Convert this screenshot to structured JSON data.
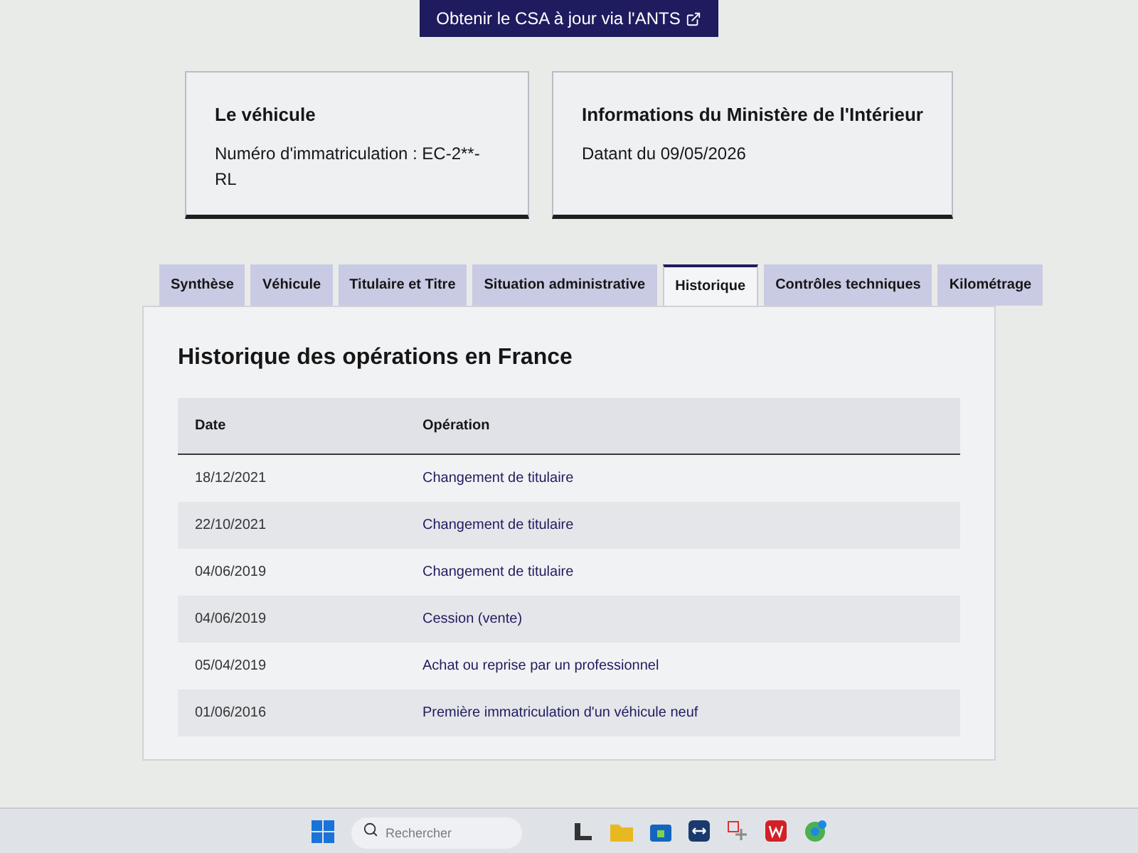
{
  "top_button": {
    "label": "Obtenir le CSA à jour via l'ANTS"
  },
  "cards": [
    {
      "title": "Le véhicule",
      "text": "Numéro d'immatriculation : EC-2**-RL"
    },
    {
      "title": "Informations du Ministère de l'Intérieur",
      "text": "Datant du 09/05/2026"
    }
  ],
  "tabs": [
    {
      "label": "Synthèse",
      "selected": false
    },
    {
      "label": "Véhicule",
      "selected": false
    },
    {
      "label": "Titulaire et Titre",
      "selected": false
    },
    {
      "label": "Situation administrative",
      "selected": false
    },
    {
      "label": "Historique",
      "selected": true
    },
    {
      "label": "Contrôles techniques",
      "selected": false
    },
    {
      "label": "Kilométrage",
      "selected": false
    }
  ],
  "panel": {
    "title": "Historique des opérations en France",
    "table": {
      "columns": [
        "Date",
        "Opération"
      ],
      "rows": [
        [
          "18/12/2021",
          "Changement de titulaire"
        ],
        [
          "22/10/2021",
          "Changement de titulaire"
        ],
        [
          "04/06/2019",
          "Changement de titulaire"
        ],
        [
          "04/06/2019",
          "Cession (vente)"
        ],
        [
          "05/04/2019",
          "Achat ou reprise par un professionnel"
        ],
        [
          "01/06/2016",
          "Première immatriculation d'un véhicule neuf"
        ]
      ]
    }
  },
  "taskbar": {
    "search": {
      "placeholder": "Rechercher"
    }
  }
}
